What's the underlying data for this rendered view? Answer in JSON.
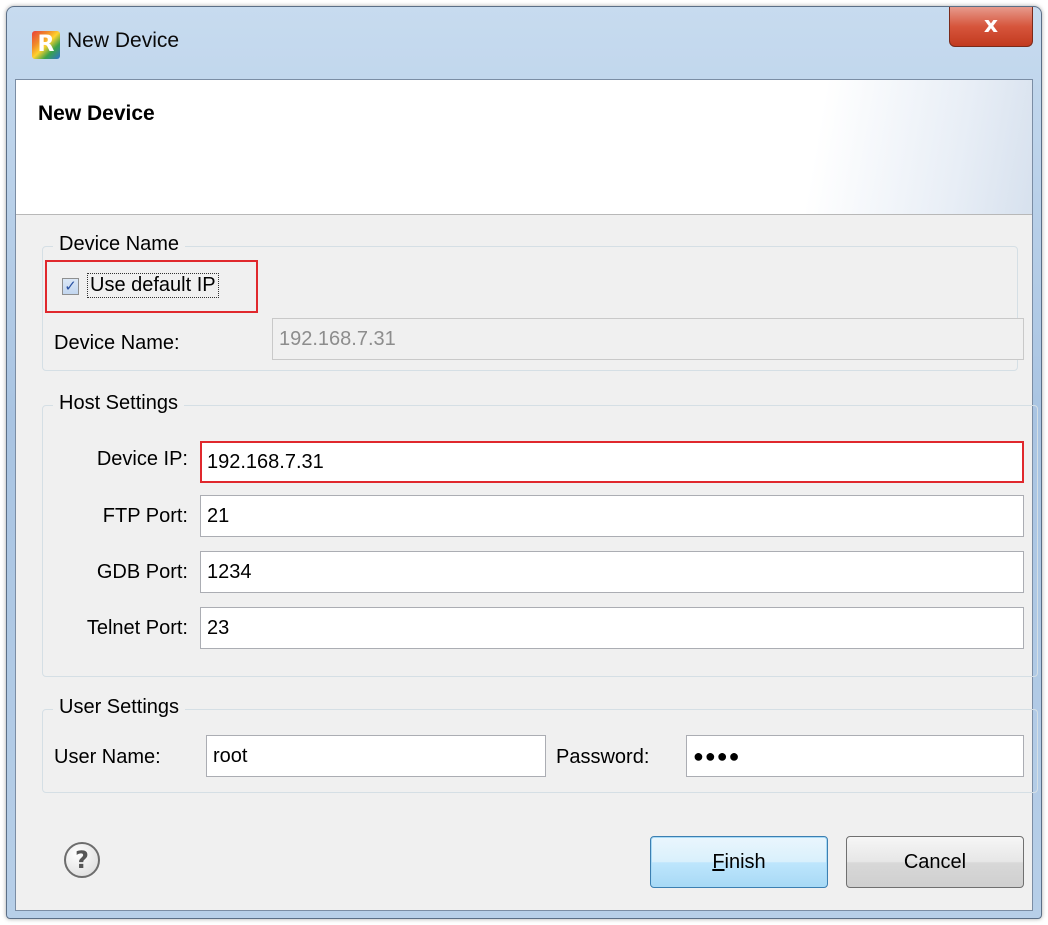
{
  "window": {
    "title": "New Device",
    "close_glyph": "x",
    "app_icon_letter": "R"
  },
  "banner": {
    "title": "New Device"
  },
  "device_name_group": {
    "legend": "Device Name",
    "use_default_ip": {
      "label": "Use default IP",
      "checked": true
    },
    "device_name_label": "Device Name:",
    "device_name_value": "192.168.7.31"
  },
  "host_settings_group": {
    "legend": "Host Settings",
    "device_ip_label": "Device IP:",
    "device_ip_value": "192.168.7.31",
    "ftp_port_label": "FTP Port:",
    "ftp_port_value": "21",
    "gdb_port_label": "GDB Port:",
    "gdb_port_value": "1234",
    "telnet_port_label": "Telnet Port:",
    "telnet_port_value": "23"
  },
  "user_settings_group": {
    "legend": "User Settings",
    "user_name_label": "User Name:",
    "user_name_value": "root",
    "password_label": "Password:",
    "password_masked": "●●●●"
  },
  "footer": {
    "help_glyph": "?",
    "finish_mnemonic": "F",
    "finish_rest": "inish",
    "cancel_label": "Cancel"
  },
  "colors": {
    "highlight": "#e0282d",
    "default_button_border": "#3c7fb1"
  }
}
